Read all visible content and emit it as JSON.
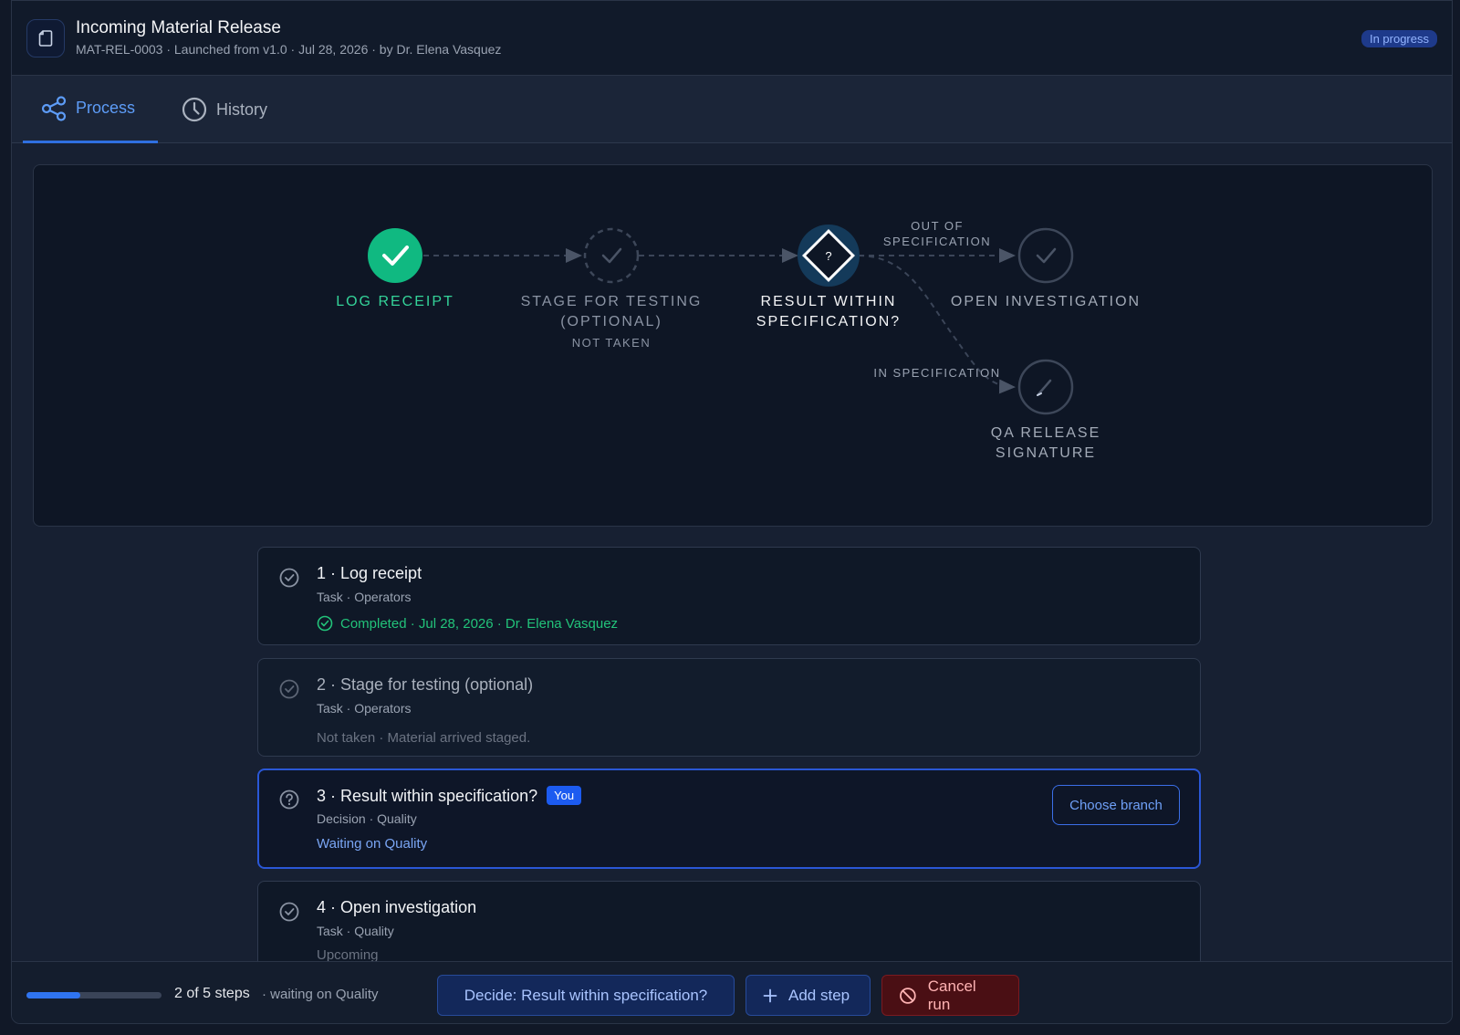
{
  "header": {
    "title": "Incoming Material Release",
    "subtitle": "MAT-REL-0003 · Launched from v1.0 · Jul 28, 2026 · by Dr. Elena Vasquez",
    "status": "In progress"
  },
  "tabs": [
    {
      "label": "Process",
      "icon": "share-icon",
      "active": true
    },
    {
      "label": "History",
      "icon": "clock-icon",
      "active": false
    }
  ],
  "flow": {
    "nodes": [
      {
        "label_line1": "LOG RECEIPT",
        "label_line2": "",
        "sub": "",
        "state": "completed"
      },
      {
        "label_line1": "STAGE FOR TESTING",
        "label_line2": "(OPTIONAL)",
        "sub": "NOT TAKEN",
        "state": "skipped"
      },
      {
        "label_line1": "RESULT WITHIN",
        "label_line2": "SPECIFICATION?",
        "sub": "",
        "state": "current",
        "glyph": "?"
      },
      {
        "label_line1": "OPEN INVESTIGATION",
        "label_line2": "",
        "sub": "",
        "state": "upcoming"
      },
      {
        "label_line1": "QA RELEASE",
        "label_line2": "SIGNATURE",
        "sub": "",
        "state": "upcoming"
      }
    ],
    "edges": [
      {
        "label_line1": "OUT OF",
        "label_line2": "SPECIFICATION"
      },
      {
        "label_line1": "IN SPECIFICATION",
        "label_line2": ""
      }
    ],
    "colors": {
      "completed": "#10b981",
      "current_ring": "#143a5a",
      "line": "#3b4558"
    }
  },
  "steps": [
    {
      "title": "1 · Log receipt",
      "meta": "Task · Operators",
      "status": "Completed · Jul 28, 2026 · Dr. Elena Vasquez",
      "state": "completed"
    },
    {
      "title": "2 · Stage for testing (optional)",
      "meta": "Task · Operators",
      "status": "Not taken · Material arrived staged.",
      "state": "skipped"
    },
    {
      "title": "3 · Result within specification?",
      "badge": "You",
      "meta": "Decision · Quality",
      "status": "Waiting on Quality",
      "action": "Choose branch",
      "state": "active"
    },
    {
      "title": "4 · Open investigation",
      "meta": "Task · Quality",
      "status": "Upcoming",
      "state": "upcoming"
    }
  ],
  "footer": {
    "progress_fraction": 0.4,
    "progress_text": "2 of 5 steps",
    "progress_extra": "· waiting on Quality",
    "decide_label": "Decide: Result within specification?",
    "add_step_label": "Add step",
    "cancel_label": "Cancel run"
  }
}
